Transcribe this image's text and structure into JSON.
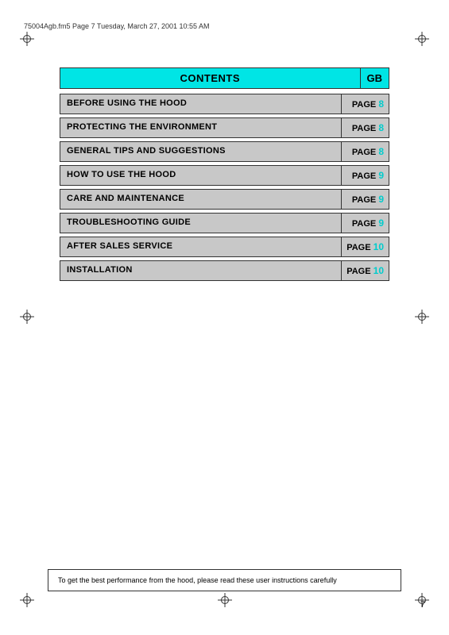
{
  "header": {
    "file_info": "75004Agb.fm5  Page 7  Tuesday, March 27, 2001  10:55 AM"
  },
  "contents": {
    "title": "CONTENTS",
    "gb_label": "GB",
    "rows": [
      {
        "title": "BEFORE USING THE HOOD",
        "page_label": "PAGE",
        "page_num": "8"
      },
      {
        "title": "PROTECTING THE ENVIRONMENT",
        "page_label": "PAGE",
        "page_num": "8"
      },
      {
        "title": "GENERAL TIPS AND SUGGESTIONS",
        "page_label": "PAGE",
        "page_num": "8"
      },
      {
        "title": "HOW TO USE THE HOOD",
        "page_label": "PAGE",
        "page_num": "9"
      },
      {
        "title": "CARE AND MAINTENANCE",
        "page_label": "PAGE",
        "page_num": "9"
      },
      {
        "title": "TROUBLESHOOTING GUIDE",
        "page_label": "PAGE",
        "page_num": "9"
      },
      {
        "title": "AFTER SALES SERVICE",
        "page_label": "PAGE",
        "page_num": "10"
      },
      {
        "title": "INSTALLATION",
        "page_label": "PAGE",
        "page_num": "10"
      }
    ]
  },
  "footer": {
    "note": "To get the best performance from the hood, please read these user instructions carefully",
    "page_number": "7"
  }
}
